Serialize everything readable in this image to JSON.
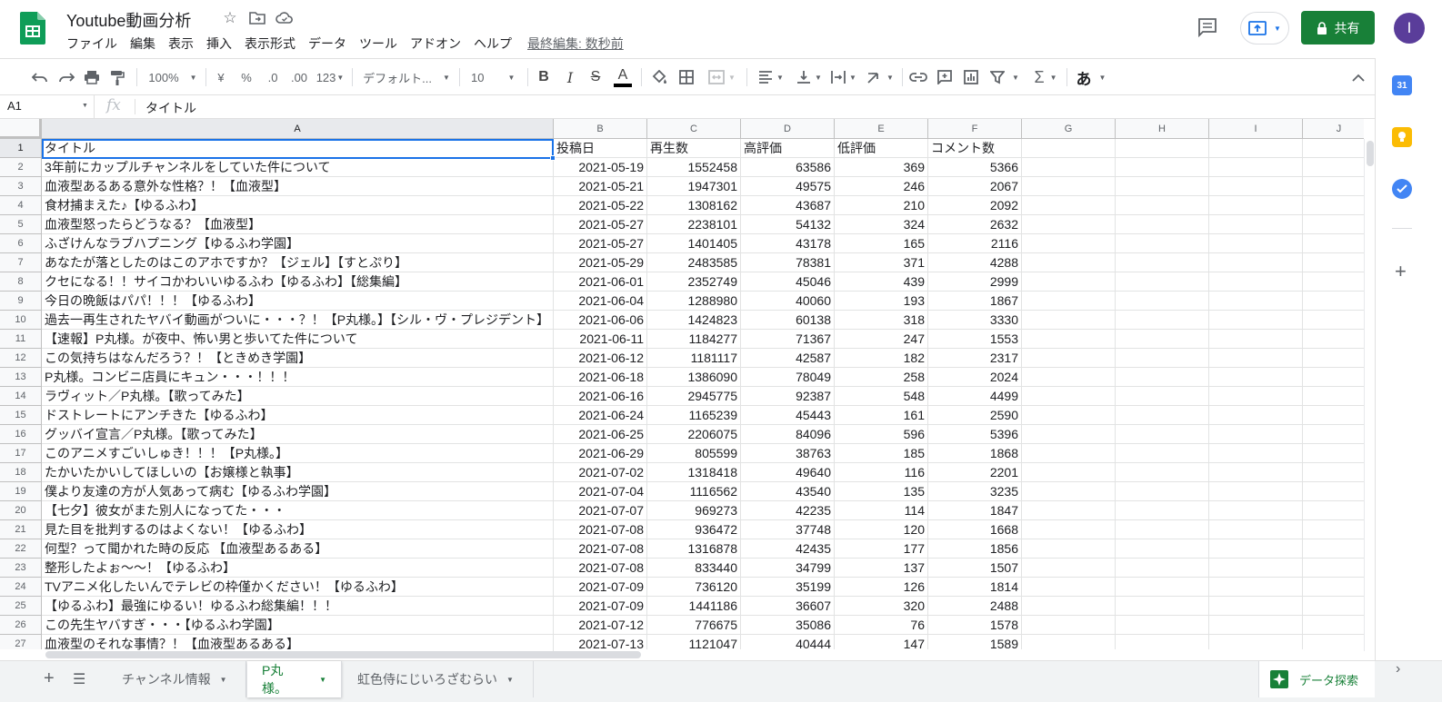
{
  "app": {
    "doc_title": "Youtube動画分析",
    "menus": [
      "ファイル",
      "編集",
      "表示",
      "挿入",
      "表示形式",
      "データ",
      "ツール",
      "アドオン",
      "ヘルプ"
    ],
    "last_edit": "最終編集: 数秒前",
    "share_label": "共有",
    "avatar_letter": "I",
    "brand_color": "#188038",
    "accent_color": "#1a73e8"
  },
  "toolbar": {
    "zoom": "100%",
    "currency": "¥",
    "percent": "%",
    "dec_decrease": ".0",
    "dec_increase": ".00",
    "more_formats": "123",
    "font": "デフォルト...",
    "font_size": "10",
    "bold": "B",
    "italic": "I",
    "strike": "S",
    "text_color": "A",
    "input_tools": "あ"
  },
  "formula_bar": {
    "cell_ref": "A1",
    "fx": "fx",
    "value": "タイトル"
  },
  "columns": [
    "A",
    "B",
    "C",
    "D",
    "E",
    "F",
    "G",
    "H",
    "I",
    "J"
  ],
  "header_row": [
    "タイトル",
    "投稿日",
    "再生数",
    "高評価",
    "低評価",
    "コメント数"
  ],
  "rows": [
    [
      "3年前にカップルチャンネルをしていた件について",
      "2021-05-19",
      "1552458",
      "63586",
      "369",
      "5366"
    ],
    [
      "血液型あるある意外な性格？！【血液型】",
      "2021-05-21",
      "1947301",
      "49575",
      "246",
      "2067"
    ],
    [
      "食材捕まえた♪【ゆるふわ】",
      "2021-05-22",
      "1308162",
      "43687",
      "210",
      "2092"
    ],
    [
      "血液型怒ったらどうなる？【血液型】",
      "2021-05-27",
      "2238101",
      "54132",
      "324",
      "2632"
    ],
    [
      "ふざけんなラブハプニング【ゆるふわ学園】",
      "2021-05-27",
      "1401405",
      "43178",
      "165",
      "2116"
    ],
    [
      "あなたが落としたのはこのアホですか？【ジェル】【すとぷり】",
      "2021-05-29",
      "2483585",
      "78381",
      "371",
      "4288"
    ],
    [
      "クセになる！！サイコかわいいゆるふわ【ゆるふわ】【総集編】",
      "2021-06-01",
      "2352749",
      "45046",
      "439",
      "2999"
    ],
    [
      "今日の晩飯はパパ！！！【ゆるふわ】",
      "2021-06-04",
      "1288980",
      "40060",
      "193",
      "1867"
    ],
    [
      "過去一再生されたヤバイ動画がついに・・・？！【P丸様。】【シル・ヴ・プレジデント】",
      "2021-06-06",
      "1424823",
      "60138",
      "318",
      "3330"
    ],
    [
      "【速報】P丸様。が夜中、怖い男と歩いてた件について",
      "2021-06-11",
      "1184277",
      "71367",
      "247",
      "1553"
    ],
    [
      "この気持ちはなんだろう？！【ときめき学園】",
      "2021-06-12",
      "1181117",
      "42587",
      "182",
      "2317"
    ],
    [
      "P丸様。コンビニ店員にキュン・・・！！！",
      "2021-06-18",
      "1386090",
      "78049",
      "258",
      "2024"
    ],
    [
      "ラヴィット／P丸様。【歌ってみた】",
      "2021-06-16",
      "2945775",
      "92387",
      "548",
      "4499"
    ],
    [
      "ドストレートにアンチきた【ゆるふわ】",
      "2021-06-24",
      "1165239",
      "45443",
      "161",
      "2590"
    ],
    [
      "グッバイ宣言／P丸様。【歌ってみた】",
      "2021-06-25",
      "2206075",
      "84096",
      "596",
      "5396"
    ],
    [
      "このアニメすごいしゅき！！！【P丸様。】",
      "2021-06-29",
      "805599",
      "38763",
      "185",
      "1868"
    ],
    [
      "たかいたかいしてほしいの【お嬢様と執事】",
      "2021-07-02",
      "1318418",
      "49640",
      "116",
      "2201"
    ],
    [
      "僕より友達の方が人気あって病む【ゆるふわ学園】",
      "2021-07-04",
      "1116562",
      "43540",
      "135",
      "3235"
    ],
    [
      "【七夕】彼女がまた別人になってた・・・",
      "2021-07-07",
      "969273",
      "42235",
      "114",
      "1847"
    ],
    [
      "見た目を批判するのはよくない！【ゆるふわ】",
      "2021-07-08",
      "936472",
      "37748",
      "120",
      "1668"
    ],
    [
      "何型？って聞かれた時の反応 【血液型あるある】",
      "2021-07-08",
      "1316878",
      "42435",
      "177",
      "1856"
    ],
    [
      "整形したよぉ〜〜！【ゆるふわ】",
      "2021-07-08",
      "833440",
      "34799",
      "137",
      "1507"
    ],
    [
      "TVアニメ化したいんでテレビの枠僅かください！【ゆるふわ】",
      "2021-07-09",
      "736120",
      "35199",
      "126",
      "1814"
    ],
    [
      "【ゆるふわ】最強にゆるい！ゆるふわ総集編！！！",
      "2021-07-09",
      "1441186",
      "36607",
      "320",
      "2488"
    ],
    [
      "この先生ヤバすぎ・・・【ゆるふわ学園】",
      "2021-07-12",
      "776675",
      "35086",
      "76",
      "1578"
    ],
    [
      "血液型のそれな事情？！【血液型あるある】",
      "2021-07-13",
      "1121047",
      "40444",
      "147",
      "1589"
    ]
  ],
  "sheet_tabs": [
    {
      "label": "チャンネル情報",
      "active": false
    },
    {
      "label": "P丸様。",
      "active": true
    },
    {
      "label": "虹色侍にじいろざむらい",
      "active": false
    }
  ],
  "explore_label": "データ探索"
}
